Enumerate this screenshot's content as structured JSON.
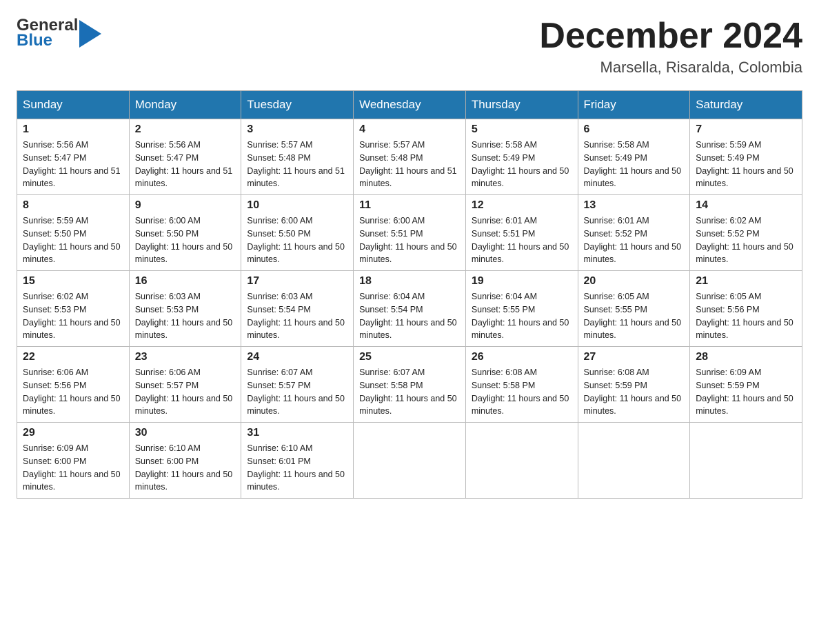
{
  "logo": {
    "text_general": "General",
    "text_blue": "Blue",
    "aria": "GeneralBlue logo"
  },
  "header": {
    "month_year": "December 2024",
    "location": "Marsella, Risaralda, Colombia"
  },
  "days_of_week": [
    "Sunday",
    "Monday",
    "Tuesday",
    "Wednesday",
    "Thursday",
    "Friday",
    "Saturday"
  ],
  "weeks": [
    [
      {
        "day": "1",
        "sunrise": "5:56 AM",
        "sunset": "5:47 PM",
        "daylight": "11 hours and 51 minutes."
      },
      {
        "day": "2",
        "sunrise": "5:56 AM",
        "sunset": "5:47 PM",
        "daylight": "11 hours and 51 minutes."
      },
      {
        "day": "3",
        "sunrise": "5:57 AM",
        "sunset": "5:48 PM",
        "daylight": "11 hours and 51 minutes."
      },
      {
        "day": "4",
        "sunrise": "5:57 AM",
        "sunset": "5:48 PM",
        "daylight": "11 hours and 51 minutes."
      },
      {
        "day": "5",
        "sunrise": "5:58 AM",
        "sunset": "5:49 PM",
        "daylight": "11 hours and 50 minutes."
      },
      {
        "day": "6",
        "sunrise": "5:58 AM",
        "sunset": "5:49 PM",
        "daylight": "11 hours and 50 minutes."
      },
      {
        "day": "7",
        "sunrise": "5:59 AM",
        "sunset": "5:49 PM",
        "daylight": "11 hours and 50 minutes."
      }
    ],
    [
      {
        "day": "8",
        "sunrise": "5:59 AM",
        "sunset": "5:50 PM",
        "daylight": "11 hours and 50 minutes."
      },
      {
        "day": "9",
        "sunrise": "6:00 AM",
        "sunset": "5:50 PM",
        "daylight": "11 hours and 50 minutes."
      },
      {
        "day": "10",
        "sunrise": "6:00 AM",
        "sunset": "5:50 PM",
        "daylight": "11 hours and 50 minutes."
      },
      {
        "day": "11",
        "sunrise": "6:00 AM",
        "sunset": "5:51 PM",
        "daylight": "11 hours and 50 minutes."
      },
      {
        "day": "12",
        "sunrise": "6:01 AM",
        "sunset": "5:51 PM",
        "daylight": "11 hours and 50 minutes."
      },
      {
        "day": "13",
        "sunrise": "6:01 AM",
        "sunset": "5:52 PM",
        "daylight": "11 hours and 50 minutes."
      },
      {
        "day": "14",
        "sunrise": "6:02 AM",
        "sunset": "5:52 PM",
        "daylight": "11 hours and 50 minutes."
      }
    ],
    [
      {
        "day": "15",
        "sunrise": "6:02 AM",
        "sunset": "5:53 PM",
        "daylight": "11 hours and 50 minutes."
      },
      {
        "day": "16",
        "sunrise": "6:03 AM",
        "sunset": "5:53 PM",
        "daylight": "11 hours and 50 minutes."
      },
      {
        "day": "17",
        "sunrise": "6:03 AM",
        "sunset": "5:54 PM",
        "daylight": "11 hours and 50 minutes."
      },
      {
        "day": "18",
        "sunrise": "6:04 AM",
        "sunset": "5:54 PM",
        "daylight": "11 hours and 50 minutes."
      },
      {
        "day": "19",
        "sunrise": "6:04 AM",
        "sunset": "5:55 PM",
        "daylight": "11 hours and 50 minutes."
      },
      {
        "day": "20",
        "sunrise": "6:05 AM",
        "sunset": "5:55 PM",
        "daylight": "11 hours and 50 minutes."
      },
      {
        "day": "21",
        "sunrise": "6:05 AM",
        "sunset": "5:56 PM",
        "daylight": "11 hours and 50 minutes."
      }
    ],
    [
      {
        "day": "22",
        "sunrise": "6:06 AM",
        "sunset": "5:56 PM",
        "daylight": "11 hours and 50 minutes."
      },
      {
        "day": "23",
        "sunrise": "6:06 AM",
        "sunset": "5:57 PM",
        "daylight": "11 hours and 50 minutes."
      },
      {
        "day": "24",
        "sunrise": "6:07 AM",
        "sunset": "5:57 PM",
        "daylight": "11 hours and 50 minutes."
      },
      {
        "day": "25",
        "sunrise": "6:07 AM",
        "sunset": "5:58 PM",
        "daylight": "11 hours and 50 minutes."
      },
      {
        "day": "26",
        "sunrise": "6:08 AM",
        "sunset": "5:58 PM",
        "daylight": "11 hours and 50 minutes."
      },
      {
        "day": "27",
        "sunrise": "6:08 AM",
        "sunset": "5:59 PM",
        "daylight": "11 hours and 50 minutes."
      },
      {
        "day": "28",
        "sunrise": "6:09 AM",
        "sunset": "5:59 PM",
        "daylight": "11 hours and 50 minutes."
      }
    ],
    [
      {
        "day": "29",
        "sunrise": "6:09 AM",
        "sunset": "6:00 PM",
        "daylight": "11 hours and 50 minutes."
      },
      {
        "day": "30",
        "sunrise": "6:10 AM",
        "sunset": "6:00 PM",
        "daylight": "11 hours and 50 minutes."
      },
      {
        "day": "31",
        "sunrise": "6:10 AM",
        "sunset": "6:01 PM",
        "daylight": "11 hours and 50 minutes."
      },
      null,
      null,
      null,
      null
    ]
  ],
  "labels": {
    "sunrise": "Sunrise:",
    "sunset": "Sunset:",
    "daylight": "Daylight:"
  },
  "accent_color": "#2176ae"
}
